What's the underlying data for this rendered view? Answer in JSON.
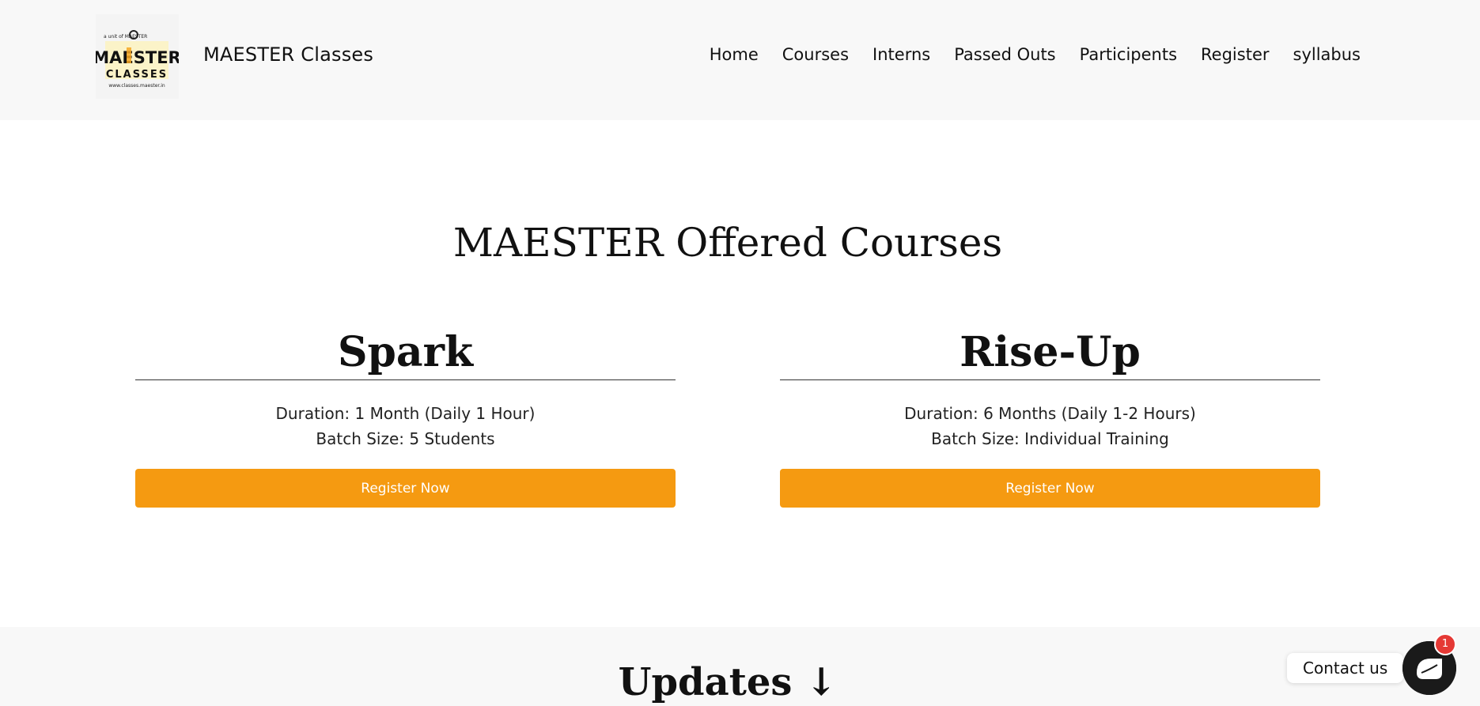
{
  "header": {
    "brand": "MAESTER Classes",
    "logo": {
      "tagline": "a unit of MAESTER",
      "line1": "MAESTER",
      "line2": "CLASSES",
      "url": "www.classes.maester.in",
      "accent": "#f5a623"
    },
    "nav": [
      {
        "label": "Home"
      },
      {
        "label": "Courses"
      },
      {
        "label": "Interns"
      },
      {
        "label": "Passed Outs"
      },
      {
        "label": "Participents"
      },
      {
        "label": "Register"
      },
      {
        "label": "syllabus"
      }
    ]
  },
  "main": {
    "title": "MAESTER Offered Courses",
    "courses": [
      {
        "name": "Spark",
        "duration": "Duration: 1 Month (Daily 1 Hour)",
        "batch": "Batch Size: 5 Students",
        "button": "Register Now"
      },
      {
        "name": "Rise-Up",
        "duration": "Duration: 6 Months (Daily 1-2 Hours)",
        "batch": "Batch Size: Individual Training",
        "button": "Register Now"
      }
    ]
  },
  "updates": {
    "title": "Updates ↓"
  },
  "contact": {
    "label": "Contact us",
    "badge": "1"
  },
  "colors": {
    "accent": "#f59a11",
    "header_bg": "#f8f8f8",
    "badge": "#e53935"
  }
}
